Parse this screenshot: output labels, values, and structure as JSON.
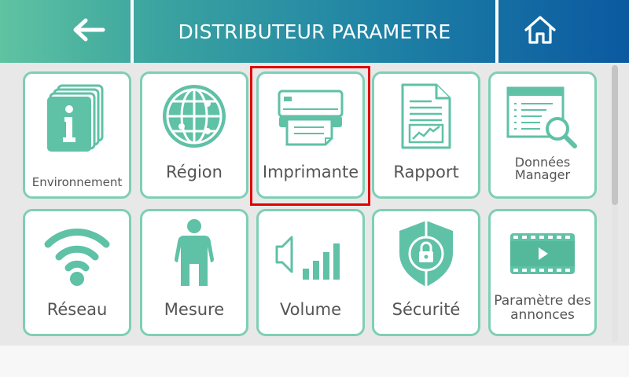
{
  "header": {
    "title": "DISTRIBUTEUR PARAMETRE",
    "back_icon": "arrow-left-icon",
    "home_icon": "home-icon"
  },
  "colors": {
    "accent": "#5fc1a6",
    "tile_border": "#7ecfb5",
    "selection": "#e00000",
    "header_start": "#5fc3a1",
    "header_end": "#0b59a1"
  },
  "tiles": [
    {
      "label": "Environnement",
      "icon": "info-cards-icon"
    },
    {
      "label": "Région",
      "icon": "globe-icon"
    },
    {
      "label": "Imprimante",
      "icon": "printer-icon",
      "selected": true
    },
    {
      "label": "Rapport",
      "icon": "report-icon"
    },
    {
      "label": "Données Manager",
      "icon": "data-search-icon"
    },
    {
      "label": "Réseau",
      "icon": "wifi-icon"
    },
    {
      "label": "Mesure",
      "icon": "person-icon"
    },
    {
      "label": "Volume",
      "icon": "volume-icon"
    },
    {
      "label": "Sécurité",
      "icon": "security-shield-icon"
    },
    {
      "label": "Paramètre des annonces",
      "icon": "video-icon"
    }
  ]
}
